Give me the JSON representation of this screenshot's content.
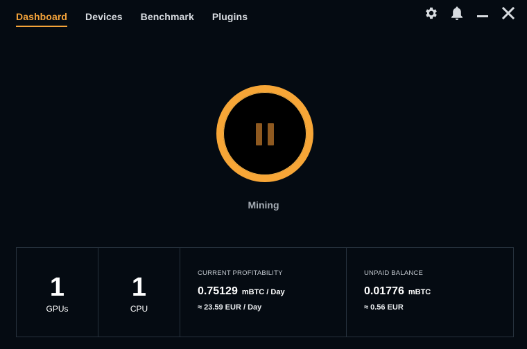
{
  "nav": {
    "tabs": [
      {
        "label": "Dashboard",
        "active": true
      },
      {
        "label": "Devices"
      },
      {
        "label": "Benchmark"
      },
      {
        "label": "Plugins"
      }
    ]
  },
  "window_controls": {
    "icons": [
      "gear-icon",
      "bell-icon",
      "minimize-icon",
      "close-icon"
    ]
  },
  "mining": {
    "status": "Mining",
    "button_icon": "pause-icon",
    "ring_color": "#f7a637"
  },
  "stats": {
    "gpus": {
      "count": "1",
      "label": "GPUs"
    },
    "cpu": {
      "count": "1",
      "label": "CPU"
    },
    "profitability": {
      "title": "CURRENT PROFITABILITY",
      "value": "0.75129",
      "unit": "mBTC / Day",
      "fiat": "≈ 23.59 EUR / Day"
    },
    "balance": {
      "title": "UNPAID BALANCE",
      "value": "0.01776",
      "unit": "mBTC",
      "fiat": "≈ 0.56 EUR"
    }
  },
  "colors": {
    "accent": "#f6a43a",
    "background": "#050b12",
    "border": "#27323d"
  }
}
